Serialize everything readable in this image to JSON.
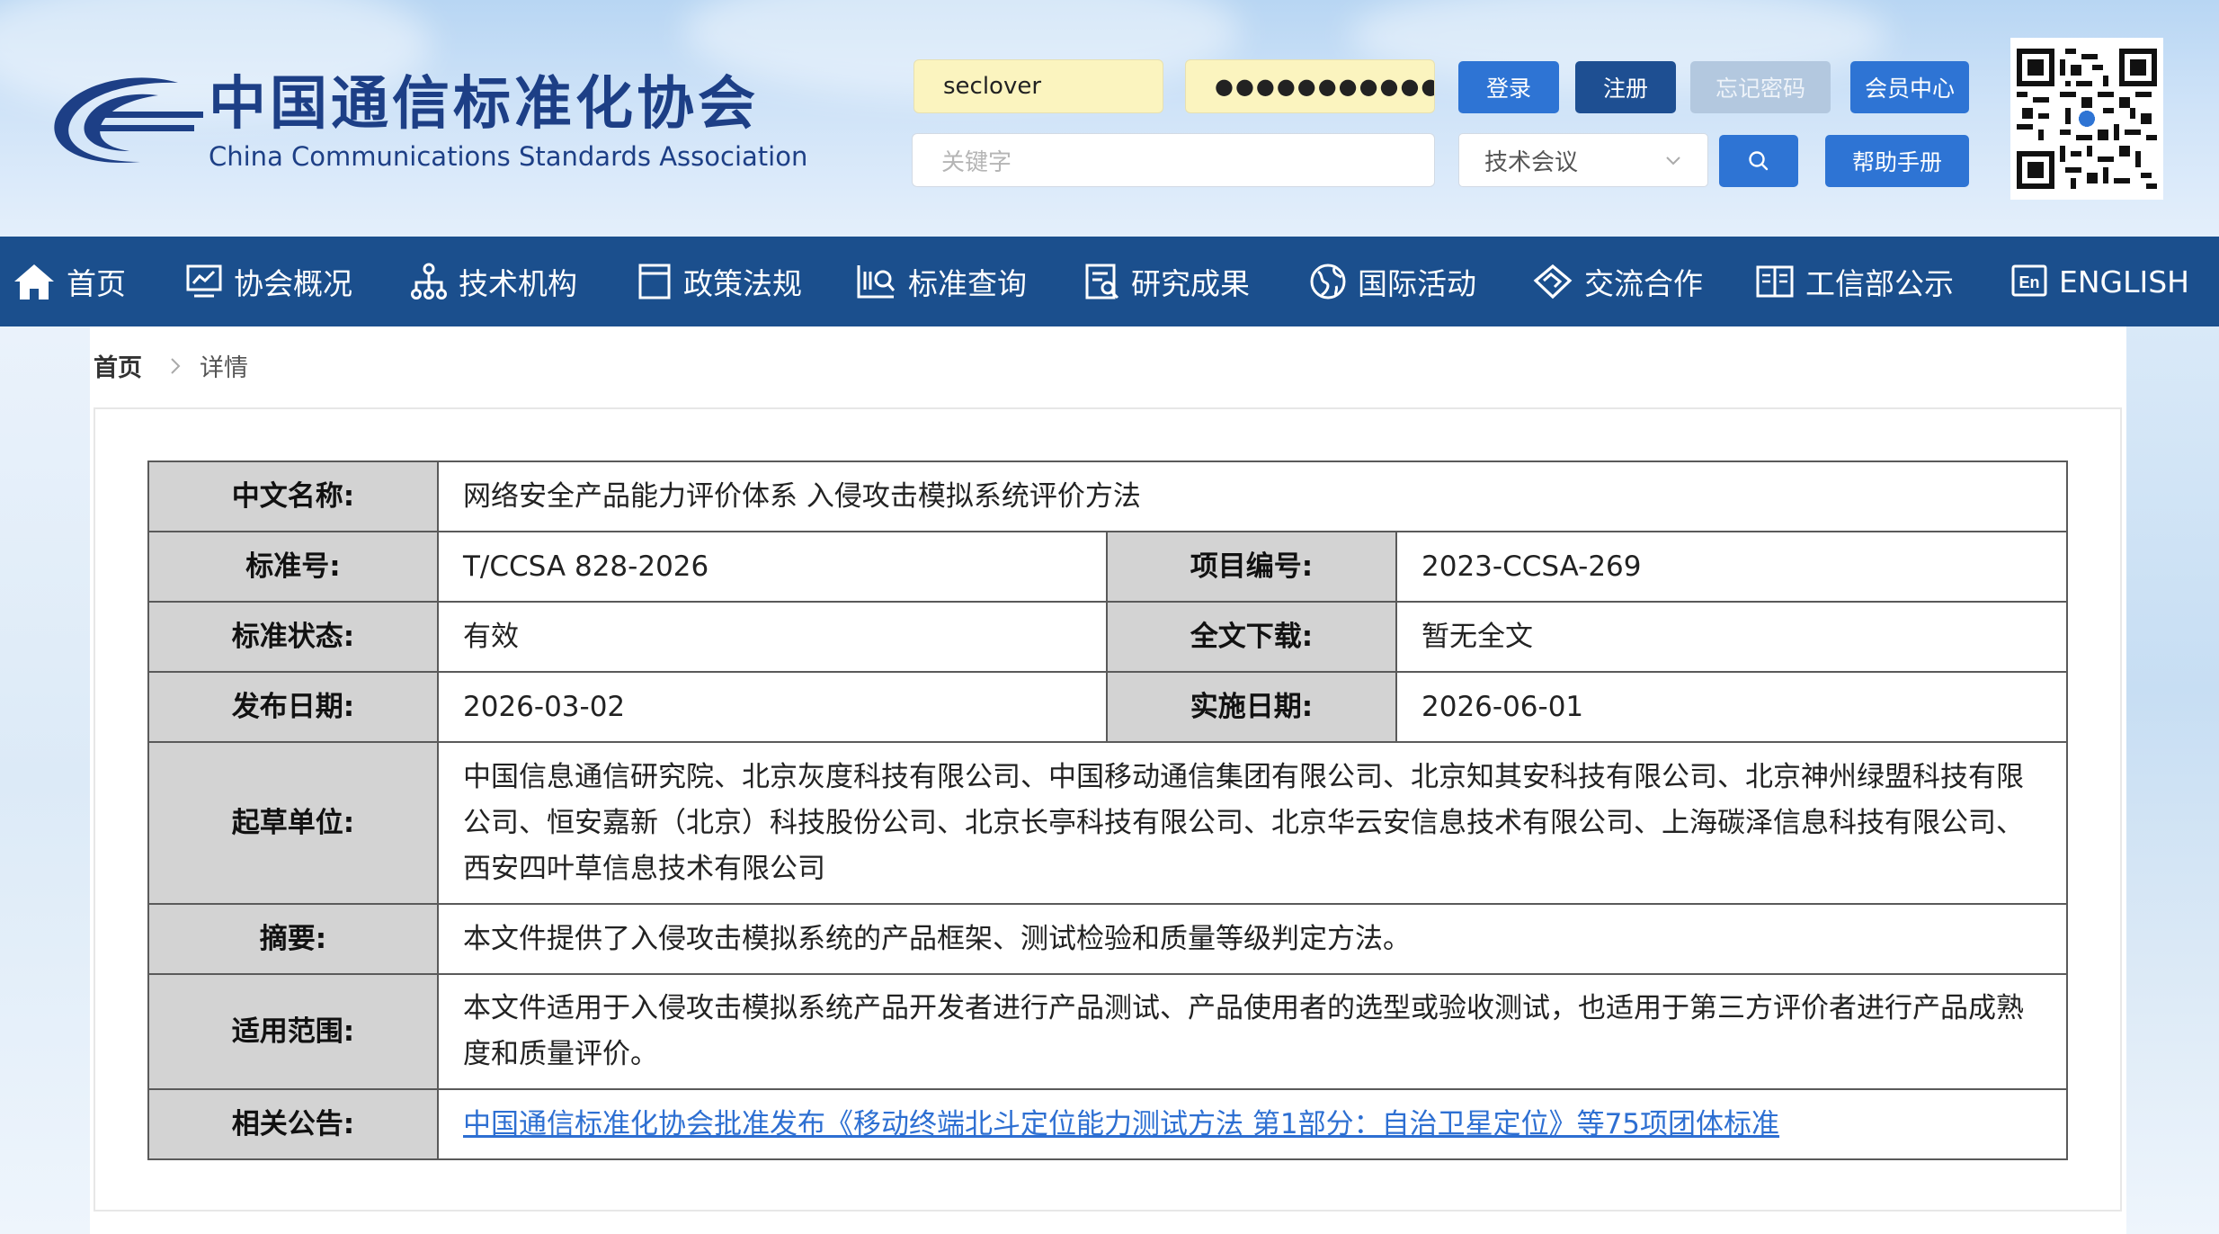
{
  "header": {
    "logo_cn": "中国通信标准化协会",
    "logo_en": "China Communications Standards Association",
    "username": "seclover",
    "password_mask": "●●●●●●●●●●●●",
    "keyword_placeholder": "关键字",
    "buttons": {
      "login": "登录",
      "register": "注册",
      "forgot": "忘记密码",
      "member": "会员中心",
      "help": "帮助手册"
    },
    "search_category": "技术会议"
  },
  "nav": {
    "items": [
      {
        "label": "首页",
        "icon": "home-icon"
      },
      {
        "label": "协会概况",
        "icon": "monitor-chart-icon"
      },
      {
        "label": "技术机构",
        "icon": "org-tree-icon"
      },
      {
        "label": "政策法规",
        "icon": "document-icon"
      },
      {
        "label": "标准查询",
        "icon": "search-list-icon"
      },
      {
        "label": "研究成果",
        "icon": "report-icon"
      },
      {
        "label": "国际活动",
        "icon": "globe-icon"
      },
      {
        "label": "交流合作",
        "icon": "handshake-icon"
      },
      {
        "label": "工信部公示",
        "icon": "book-icon"
      },
      {
        "label": "ENGLISH",
        "icon": "en-icon"
      }
    ]
  },
  "breadcrumb": {
    "home": "首页",
    "separator": ">",
    "current": "详情"
  },
  "detail": {
    "cn_name_label": "中文名称:",
    "cn_name": "网络安全产品能力评价体系 入侵攻击模拟系统评价方法",
    "std_no_label": "标准号:",
    "std_no": "T/CCSA 828-2026",
    "project_no_label": "项目编号:",
    "project_no": "2023-CCSA-269",
    "status_label": "标准状态:",
    "status": "有效",
    "download_label": "全文下载:",
    "download": "暂无全文",
    "publish_date_label": "发布日期:",
    "publish_date": "2026-03-02",
    "impl_date_label": "实施日期:",
    "impl_date": "2026-06-01",
    "drafters_label": "起草单位:",
    "drafters": "中国信息通信研究院、北京灰度科技有限公司、中国移动通信集团有限公司、北京知其安科技有限公司、北京神州绿盟科技有限公司、恒安嘉新（北京）科技股份公司、北京长亭科技有限公司、北京华云安信息技术有限公司、上海碳泽信息科技有限公司、西安四叶草信息技术有限公司",
    "abstract_label": "摘要:",
    "abstract": "本文件提供了入侵攻击模拟系统的产品框架、测试检验和质量等级判定方法。",
    "scope_label": "适用范围:",
    "scope": "本文件适用于入侵攻击模拟系统产品开发者进行产品测试、产品使用者的选型或验收测试，也适用于第三方评价者进行产品成熟度和质量评价。",
    "notice_label": "相关公告:",
    "notice": "中国通信标准化协会批准发布《移动终端北斗定位能力测试方法 第1部分：自治卫星定位》等75项团体标准"
  },
  "colors": {
    "nav_bg": "#1b4f8d",
    "brand_blue": "#1d3f86",
    "button_blue": "#2e74d4",
    "link_blue": "#2d6fd2",
    "label_bg": "#d3d3d3"
  }
}
